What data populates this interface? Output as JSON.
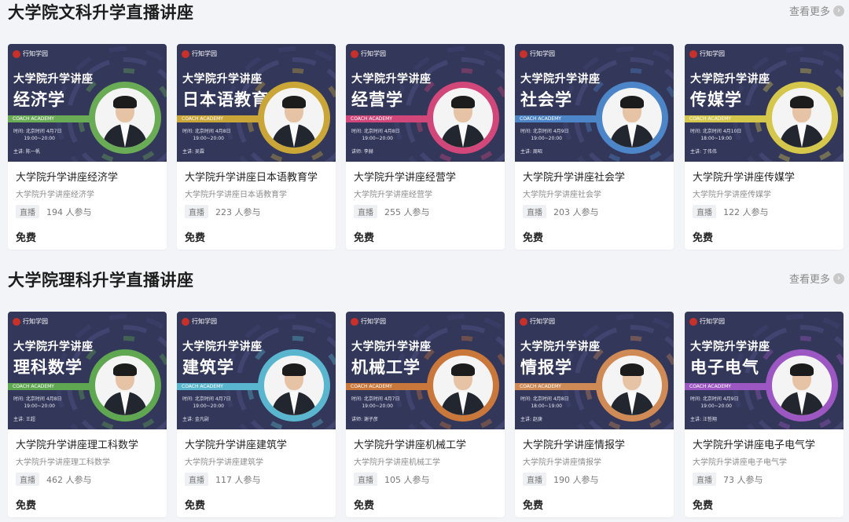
{
  "sections": [
    {
      "title": "大学院文科升学直播讲座",
      "more_label": "查看更多",
      "cards": [
        {
          "line1": "大学院升学讲座",
          "line2": "经济学",
          "bar_text": "COACH  ACADEMY",
          "info": "时间: 北京时间 4月7日\n       19:00~20:00",
          "host": "主讲: 陈一帆",
          "title": "大学院升学讲座经济学",
          "subtitle": "大学院升学讲座经济学",
          "tag": "直播",
          "participants": "194 人参与",
          "price": "免费",
          "accent": "#6aab55"
        },
        {
          "line1": "大学院升学讲座",
          "line2": "日本语教育",
          "bar_text": "COACH  ACADEMY",
          "info": "时间: 北京时间 4月8日\n       19:00~20:00",
          "host": "主讲: 吴霖",
          "title": "大学院升学讲座日本语教育学",
          "subtitle": "大学院升学讲座日本语教育学",
          "tag": "直播",
          "participants": "223 人参与",
          "price": "免费",
          "accent": "#c9a637"
        },
        {
          "line1": "大学院升学讲座",
          "line2": "经营学",
          "bar_text": "COACH  ACADEMY",
          "info": "时间: 北京时间 4月8日\n       19:00~20:00",
          "host": "讲师: 李赫",
          "title": "大学院升学讲座经营学",
          "subtitle": "大学院升学讲座经营学",
          "tag": "直播",
          "participants": "255 人参与",
          "price": "免费",
          "accent": "#d2477a"
        },
        {
          "line1": "大学院升学讲座",
          "line2": "社会学",
          "bar_text": "COACH  ACADEMY",
          "info": "时间: 北京时间 4月9日\n       19:00~20:00",
          "host": "主讲: 周昭",
          "title": "大学院升学讲座社会学",
          "subtitle": "大学院升学讲座社会学",
          "tag": "直播",
          "participants": "203 人参与",
          "price": "免费",
          "accent": "#4d86c8"
        },
        {
          "line1": "大学院升学讲座",
          "line2": "传媒学",
          "bar_text": "COACH  ACADEMY",
          "info": "时间: 北京时间 4月10日\n       18:00~19:00",
          "host": "主讲: 丁伟伟",
          "title": "大学院升学讲座传媒学",
          "subtitle": "大学院升学讲座传媒学",
          "tag": "直播",
          "participants": "122 人参与",
          "price": "免费",
          "accent": "#d5c74b"
        }
      ]
    },
    {
      "title": "大学院理科升学直播讲座",
      "more_label": "查看更多",
      "cards": [
        {
          "line1": "大学院升学讲座",
          "line2": "理科数学",
          "bar_text": "COACH  ACADEMY",
          "info": "时间: 北京时间 4月8日\n       19:00~20:00",
          "host": "主讲: 王超",
          "title": "大学院升学讲座理工科数学",
          "subtitle": "大学院升学讲座理工科数学",
          "tag": "直播",
          "participants": "462 人参与",
          "price": "免费",
          "accent": "#5fa750"
        },
        {
          "line1": "大学院升学讲座",
          "line2": "建筑学",
          "bar_text": "COACH  ACADEMY",
          "info": "时间: 北京时间 4月7日\n       19:00~20:00",
          "host": "主讲: 金凡尉",
          "title": "大学院升学讲座建筑学",
          "subtitle": "大学院升学讲座建筑学",
          "tag": "直播",
          "participants": "117 人参与",
          "price": "免费",
          "accent": "#5ab6cf"
        },
        {
          "line1": "大学院升学讲座",
          "line2": "机械工学",
          "bar_text": "COACH  ACADEMY",
          "info": "时间: 北京时间 4月7日\n       19:00~20:00",
          "host": "讲师: 谢子彦",
          "title": "大学院升学讲座机械工学",
          "subtitle": "大学院升学讲座机械工学",
          "tag": "直播",
          "participants": "105 人参与",
          "price": "免费",
          "accent": "#c9773a"
        },
        {
          "line1": "大学院升学讲座",
          "line2": "情报学",
          "bar_text": "COACH  ACADEMY",
          "info": "时间: 北京时间 4月8日\n       18:00~19:00",
          "host": "主讲: 赵庚",
          "title": "大学院升学讲座情报学",
          "subtitle": "大学院升学讲座情报学",
          "tag": "直播",
          "participants": "190 人参与",
          "price": "免费",
          "accent": "#cf8a55"
        },
        {
          "line1": "大学院升学讲座",
          "line2": "电子电气",
          "bar_text": "COACH  ACADEMY",
          "info": "时间: 北京时间 4月9日\n       19:00~20:00",
          "host": "主讲: 汪哲翔",
          "title": "大学院升学讲座电子电气学",
          "subtitle": "大学院升学讲座电子电气学",
          "tag": "直播",
          "participants": "73 人参与",
          "price": "免费",
          "accent": "#9c57c2"
        }
      ]
    }
  ],
  "logo_text": "行知学园",
  "colors": {
    "cover_bg": "#33375a",
    "page_bg": "#f3f4f7",
    "card_bg": "#ffffff"
  }
}
